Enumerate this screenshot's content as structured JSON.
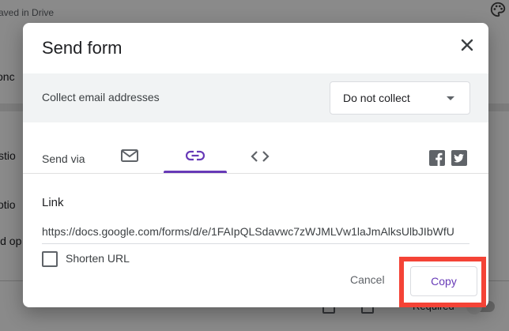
{
  "background": {
    "saved_text": "aved in Drive",
    "left_fragments": [
      "onc",
      "stio",
      "otio",
      "ld op"
    ],
    "required_label": "Required"
  },
  "dialog": {
    "title": "Send form",
    "collect": {
      "label": "Collect email addresses",
      "selected": "Do not collect"
    },
    "send_via_label": "Send via",
    "tabs": [
      {
        "name": "email",
        "active": false
      },
      {
        "name": "link",
        "active": true
      },
      {
        "name": "embed",
        "active": false
      }
    ],
    "link": {
      "label": "Link",
      "url": "https://docs.google.com/forms/d/e/1FAIpQLSdavwc7zWJMLVw1laJmAlksUlbJIbWfU",
      "shorten_label": "Shorten URL",
      "shorten_checked": false
    },
    "buttons": {
      "cancel": "Cancel",
      "copy": "Copy"
    }
  },
  "colors": {
    "accent": "#673ab7",
    "highlight": "#f44336"
  }
}
